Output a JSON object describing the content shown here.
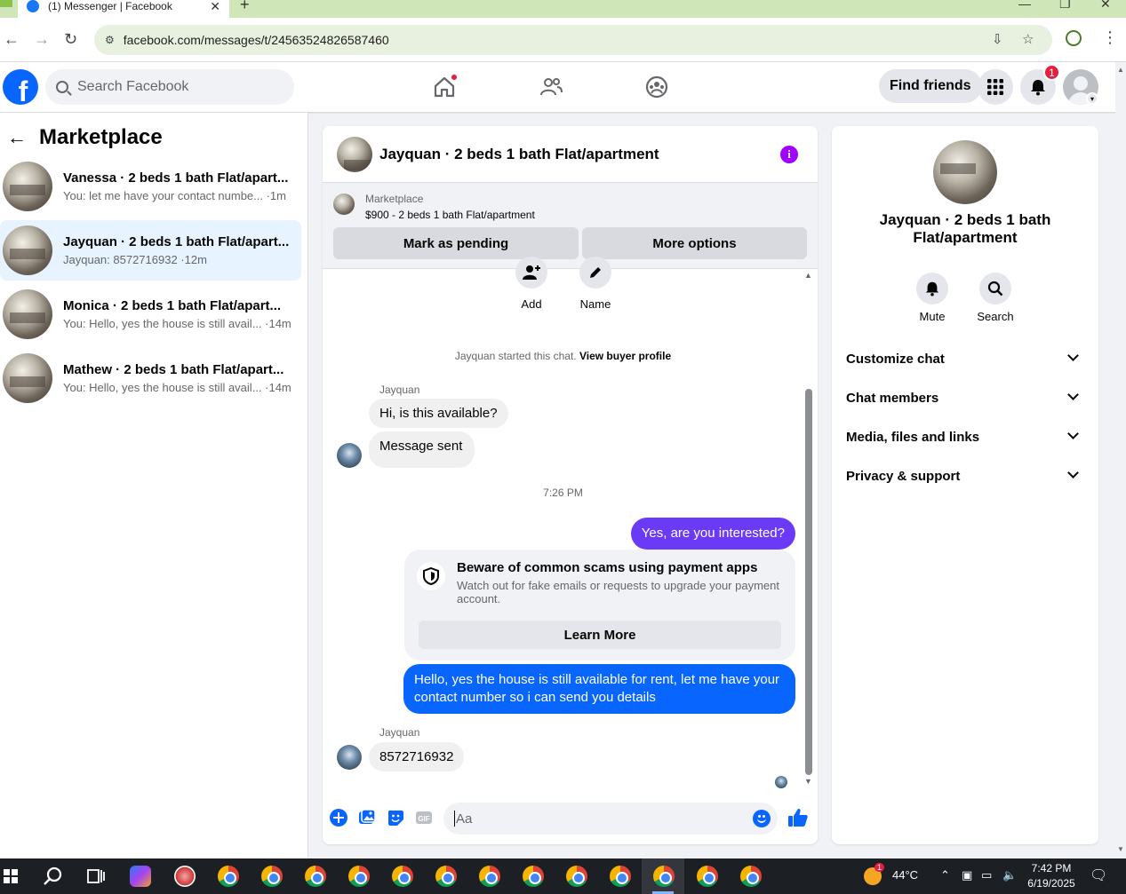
{
  "browser": {
    "tab_title": "(1) Messenger | Facebook",
    "url": "facebook.com/messages/t/24563524826587460"
  },
  "fbnav": {
    "search_placeholder": "Search Facebook",
    "find_friends": "Find friends",
    "notification_count": "1"
  },
  "left": {
    "title": "Marketplace",
    "conversations": [
      {
        "name": "Vanessa · 2 beds 1 bath Flat/apart...",
        "preview": "You: let me have your contact numbe... ·1m",
        "active": false
      },
      {
        "name": "Jayquan · 2 beds 1 bath Flat/apart...",
        "preview": "Jayquan: 8572716932 ·12m",
        "active": true
      },
      {
        "name": "Monica · 2 beds 1 bath Flat/apart...",
        "preview": "You: Hello, yes the house is still avail... ·14m",
        "active": false
      },
      {
        "name": "Mathew · 2 beds 1 bath Flat/apart...",
        "preview": "You: Hello, yes the house is still avail... ·14m",
        "active": false
      }
    ]
  },
  "chat": {
    "title": "Jayquan · 2 beds 1 bath Flat/apartment",
    "listing_source": "Marketplace",
    "listing_detail": "$900 - 2 beds 1 bath Flat/apartment",
    "mark_pending": "Mark as pending",
    "more_options": "More options",
    "add_label": "Add",
    "name_label": "Name",
    "system_text": "Jayquan started this chat.",
    "system_link": "View buyer profile",
    "sender_name": "Jayquan",
    "msg_in_1": "Hi, is this available?",
    "msg_in_2": "Message sent",
    "timestamp": "7:26 PM",
    "msg_out_1": "Yes, are you interested?",
    "scam_title": "Beware of common scams using payment apps",
    "scam_desc": "Watch out for fake emails or requests to upgrade your payment account.",
    "learn_more": "Learn More",
    "msg_out_2": "Hello, yes the house is still available for rent, let me have your contact number so i can send you details",
    "msg_in_3": "8572716932",
    "composer_placeholder": "Aa"
  },
  "right": {
    "name": "Jayquan · 2 beds 1 bath Flat/apartment",
    "mute": "Mute",
    "search": "Search",
    "rows": [
      "Customize chat",
      "Chat members",
      "Media, files and links",
      "Privacy & support"
    ]
  },
  "taskbar": {
    "temperature": "44°C",
    "weather_badge": "1",
    "time": "7:42 PM",
    "date": "6/19/2025"
  },
  "colors": {
    "fb_blue": "#0866ff",
    "outgoing_purple": "#6a3af7",
    "active_row": "#e7f3ff"
  }
}
